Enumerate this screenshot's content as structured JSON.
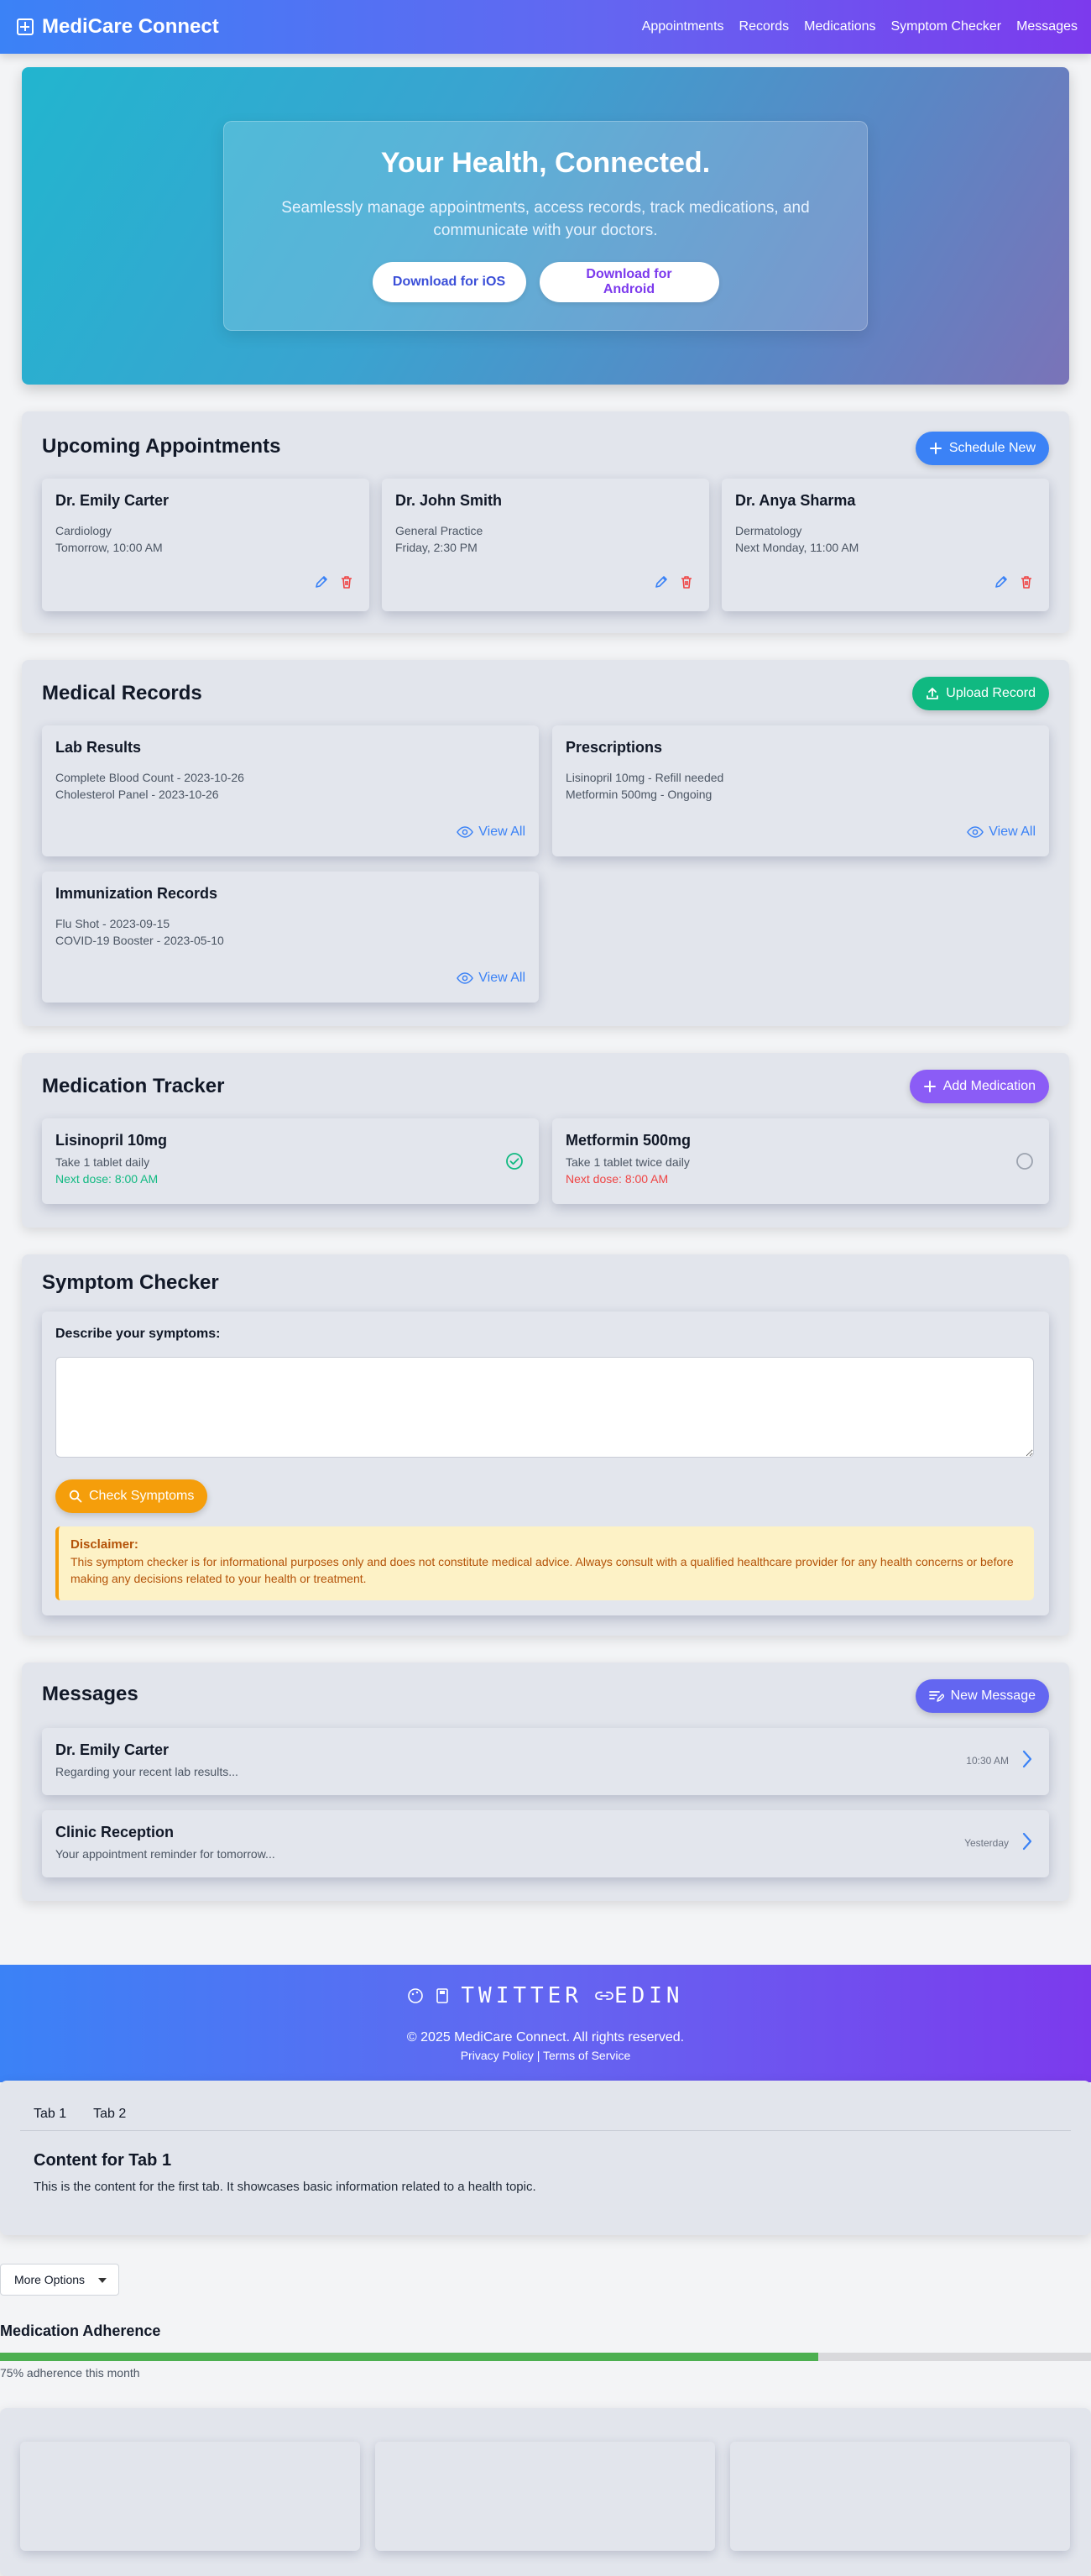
{
  "app": {
    "name": "MediCare Connect",
    "nav": [
      "Appointments",
      "Records",
      "Medications",
      "Symptom Checker",
      "Messages"
    ]
  },
  "hero": {
    "title": "Your Health, Connected.",
    "subtitle": "Seamlessly manage appointments, access records, track medications, and communicate with your doctors.",
    "ios_label": "Download for iOS",
    "android_label": "Download for Android"
  },
  "appointments": {
    "title": "Upcoming Appointments",
    "schedule_label": "Schedule New",
    "items": [
      {
        "doctor": "Dr. Emily Carter",
        "specialty": "Cardiology",
        "time": "Tomorrow, 10:00 AM"
      },
      {
        "doctor": "Dr. John Smith",
        "specialty": "General Practice",
        "time": "Friday, 2:30 PM"
      },
      {
        "doctor": "Dr. Anya Sharma",
        "specialty": "Dermatology",
        "time": "Next Monday, 11:00 AM"
      }
    ]
  },
  "records": {
    "title": "Medical Records",
    "upload_label": "Upload Record",
    "view_all_label": "View All",
    "items": [
      {
        "title": "Lab Results",
        "lines": [
          "Complete Blood Count - 2023-10-26",
          "Cholesterol Panel - 2023-10-26"
        ]
      },
      {
        "title": "Prescriptions",
        "lines": [
          "Lisinopril 10mg - Refill needed",
          "Metformin 500mg - Ongoing"
        ]
      },
      {
        "title": "Immunization Records",
        "lines": [
          "Flu Shot - 2023-09-15",
          "COVID-19 Booster - 2023-05-10"
        ]
      }
    ]
  },
  "medications": {
    "title": "Medication Tracker",
    "add_label": "Add Medication",
    "items": [
      {
        "name": "Lisinopril 10mg",
        "dosage": "Take 1 tablet daily",
        "next": "Next dose: 8:00 AM",
        "taken": true
      },
      {
        "name": "Metformin 500mg",
        "dosage": "Take 1 tablet twice daily",
        "next": "Next dose: 8:00 AM",
        "taken": false
      }
    ]
  },
  "symptoms": {
    "title": "Symptom Checker",
    "prompt": "Describe your symptoms:",
    "input_value": "",
    "check_label": "Check Symptoms",
    "disclaimer_title": "Disclaimer:",
    "disclaimer_text": "This symptom checker is for informational purposes only and does not constitute medical advice. Always consult with a qualified healthcare provider for any health concerns or before making any decisions related to your health or treatment."
  },
  "messages": {
    "title": "Messages",
    "new_label": "New Message",
    "items": [
      {
        "from": "Dr. Emily Carter",
        "preview": "Regarding your recent lab results...",
        "time": "10:30 AM"
      },
      {
        "from": "Clinic Reception",
        "preview": "Your appointment reminder for tomorrow...",
        "time": "Yesterday"
      }
    ]
  },
  "footer": {
    "social_text": "TWITTER",
    "social_text2": "EDIN",
    "copyright": "© 2025 MediCare Connect. All rights reserved.",
    "links": "Privacy Policy | Terms of Service"
  },
  "tabs": {
    "labels": [
      "Tab 1",
      "Tab 2"
    ],
    "content_title": "Content for Tab 1",
    "content_text": "This is the content for the first tab. It showcases basic information related to a health topic."
  },
  "dropdown": {
    "label": "More Options"
  },
  "adherence": {
    "title": "Medication Adherence",
    "percent": 75,
    "text": "75% adherence this month"
  },
  "colors": {
    "primary": "#3b82f6",
    "upload": "#10b981",
    "add_med": "#8b5cf6",
    "check": "#f59e0b",
    "message": "#6366f1",
    "danger": "#ef4444",
    "success": "#10b981"
  }
}
